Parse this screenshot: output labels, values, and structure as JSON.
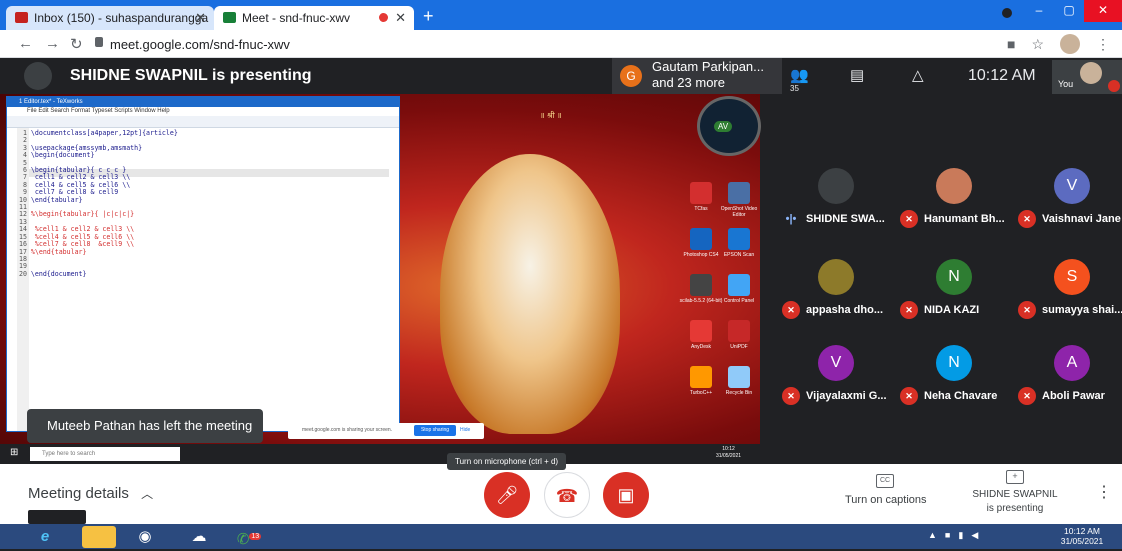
{
  "browser": {
    "tabs": [
      {
        "title": "Inbox (150) - suhaspandurangga",
        "favicon_color": "#c5221f"
      },
      {
        "title": "Meet - snd-fnuc-xwv",
        "favicon_color": "#188038"
      }
    ],
    "new_tab_symbol": "+",
    "url": "meet.google.com/snd-fnuc-xwv",
    "window_buttons": {
      "minimize": "–",
      "maximize": "▢",
      "close": "✕"
    }
  },
  "meet_header": {
    "presenter_title": "SHIDNE SWAPNIL is presenting",
    "others_avatar_letter": "G",
    "others_text_line1": "Gautam Parkipan...",
    "others_text_line2": "and 23 more",
    "people_count": "35",
    "time": "10:12 AM",
    "you_label": "You"
  },
  "shared_screen": {
    "editor_title": "1 Editor.tex* - TeXworks",
    "editor_menu": "File  Edit  Search  Format  Typeset  Scripts  Window  Help",
    "code_lines": [
      {
        "n": "1",
        "t": "\\documentclass[a4paper,12pt]{article}",
        "c": false
      },
      {
        "n": "2",
        "t": "",
        "c": false
      },
      {
        "n": "3",
        "t": "\\usepackage{amssymb,amsmath}",
        "c": false
      },
      {
        "n": "4",
        "t": "\\begin{document}",
        "c": false
      },
      {
        "n": "5",
        "t": "",
        "c": false
      },
      {
        "n": "6",
        "t": "\\begin{tabular}{ c c c }",
        "c": false
      },
      {
        "n": "7",
        "t": " cell1 & cell2 & cell3 \\\\",
        "c": false
      },
      {
        "n": "8",
        "t": " cell4 & cell5 & cell6 \\\\",
        "c": false
      },
      {
        "n": "9",
        "t": " cell7 & cell8 & cell9",
        "c": false
      },
      {
        "n": "10",
        "t": "\\end{tabular}",
        "c": false
      },
      {
        "n": "11",
        "t": "",
        "c": false
      },
      {
        "n": "12",
        "t": "%\\begin{tabular}{ |c|c|c|}",
        "c": true
      },
      {
        "n": "13",
        "t": "",
        "c": false
      },
      {
        "n": "14",
        "t": " %cell1 & cell2 & cell3 \\\\",
        "c": true
      },
      {
        "n": "15",
        "t": " %cell4 & cell5 & cell6 \\\\",
        "c": true
      },
      {
        "n": "16",
        "t": " %cell7 & cell8  &cell9 \\\\",
        "c": true
      },
      {
        "n": "17",
        "t": "%\\end{tabular}",
        "c": true
      },
      {
        "n": "18",
        "t": "",
        "c": false
      },
      {
        "n": "19",
        "t": "",
        "c": false
      },
      {
        "n": "20",
        "t": "\\end{document}",
        "c": false
      }
    ],
    "desktop_icons": [
      {
        "label": "TCfas",
        "color": "#d32f2f"
      },
      {
        "label": "OpenShot Video Editor",
        "color": "#4a6fa5"
      },
      {
        "label": "Photoshop CS4",
        "color": "#1565c0"
      },
      {
        "label": "EPSON Scan",
        "color": "#1976d2"
      },
      {
        "label": "scilab-5.5.2 (64-bit)",
        "color": "#444444"
      },
      {
        "label": "Control Panel",
        "color": "#42a5f5"
      },
      {
        "label": "AnyDesk",
        "color": "#e53935"
      },
      {
        "label": "UniPDF",
        "color": "#c62828"
      },
      {
        "label": "TurboC++",
        "color": "#ff9800"
      },
      {
        "label": "Recycle Bin",
        "color": "#90caf9"
      }
    ],
    "taskbar_search": "Type here to search",
    "taskbar_time": "10:12",
    "taskbar_date": "31/05/2021",
    "sharing_text": "meet.google.com is sharing your screen.",
    "stop_sharing": "Stop sharing",
    "hide": "Hide"
  },
  "toast": "Muteeb Pathan has left the meeting",
  "participants": [
    {
      "name": "SHIDNE SWA...",
      "avatar": "",
      "color": "#3c4043",
      "muted": false
    },
    {
      "name": "Hanumant Bh...",
      "avatar": "",
      "color": "#c97a5a",
      "muted": true
    },
    {
      "name": "Vaishnavi Jane",
      "avatar": "V",
      "color": "#5c6bc0",
      "muted": true
    },
    {
      "name": "appasha dho...",
      "avatar": "",
      "color": "#8d7a2a",
      "muted": true
    },
    {
      "name": "NIDA KAZI",
      "avatar": "N",
      "color": "#2e7d32",
      "muted": true
    },
    {
      "name": "sumayya shai...",
      "avatar": "S",
      "color": "#f4511e",
      "muted": true
    },
    {
      "name": "Vijayalaxmi G...",
      "avatar": "V",
      "color": "#8e24aa",
      "muted": true
    },
    {
      "name": "Neha Chavare",
      "avatar": "N",
      "color": "#039be5",
      "muted": true
    },
    {
      "name": "Aboli Pawar",
      "avatar": "A",
      "color": "#8e24aa",
      "muted": true
    }
  ],
  "controls": {
    "meeting_details": "Meeting details",
    "mic_tooltip": "Turn on microphone (ctrl + d)",
    "captions_label": "Turn on captions",
    "captions_icon_text": "CC",
    "present_line1": "SHIDNE SWAPNIL",
    "present_line2": "is presenting"
  },
  "windows_taskbar": {
    "time": "10:12 AM",
    "date": "31/05/2021",
    "whatsapp_badge": "13"
  }
}
